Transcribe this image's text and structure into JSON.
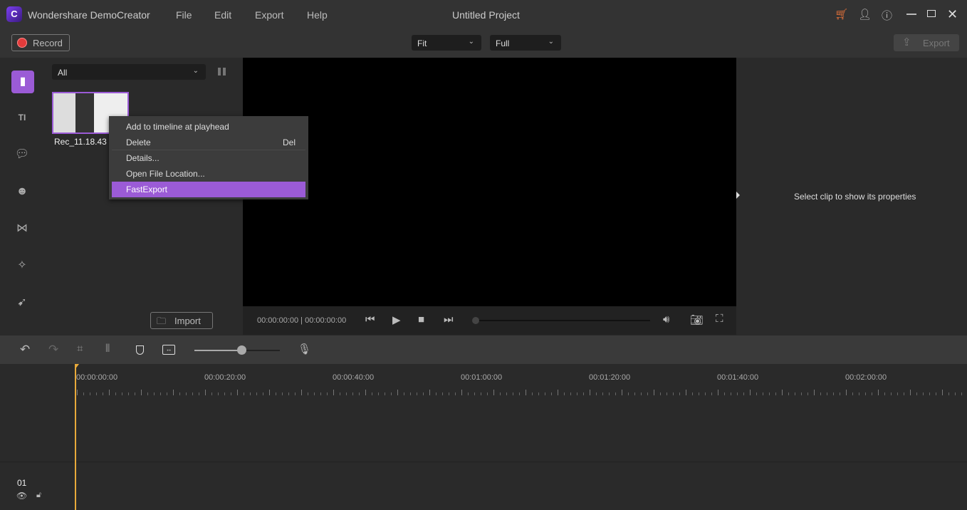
{
  "app": {
    "title": "Wondershare DemoCreator",
    "project": "Untitled Project",
    "accent": "#9b5bd6"
  },
  "menu": [
    "File",
    "Edit",
    "Export",
    "Help"
  ],
  "window_icons": [
    "cart-icon",
    "user-icon",
    "help-icon",
    "minimize-icon",
    "restore-icon",
    "close-icon"
  ],
  "toolbar": {
    "record": "Record",
    "fit": "Fit",
    "quality": "Full",
    "export": "Export"
  },
  "media": {
    "filter": "All",
    "clip_name": "Rec_11.18.43 20",
    "import": "Import"
  },
  "rail": [
    "media-icon",
    "text-icon",
    "annotation-icon",
    "sticker-icon",
    "transition-icon",
    "effects-icon",
    "cursor-icon"
  ],
  "context_menu": [
    {
      "label": "Add to timeline at playhead",
      "shortcut": ""
    },
    {
      "label": "Delete",
      "shortcut": "Del"
    },
    {
      "label": "Details...",
      "shortcut": ""
    },
    {
      "label": "Open File Location...",
      "shortcut": ""
    },
    {
      "label": "FastExport",
      "shortcut": "",
      "highlighted": true
    }
  ],
  "player": {
    "time": "00:00:00:00 | 00:00:00:00",
    "progress": 0
  },
  "props": {
    "hint": "Select clip to show its properties"
  },
  "timeline": {
    "zoom": 0.55,
    "ruler": [
      "00:00:00:00",
      "00:00:20:00",
      "00:00:40:00",
      "00:01:00:00",
      "00:01:20:00",
      "00:01:40:00",
      "00:02:00:00"
    ],
    "track": "01"
  }
}
